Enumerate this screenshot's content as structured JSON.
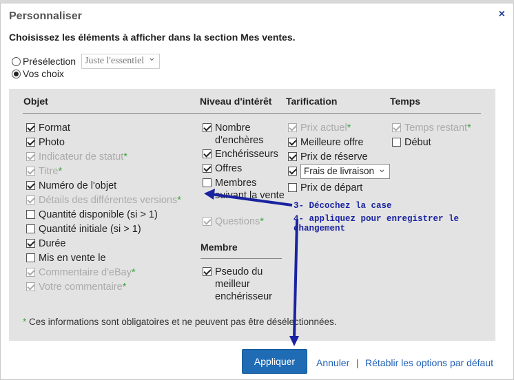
{
  "dialog": {
    "title": "Personnaliser",
    "close": "×",
    "subtitle": "Choisissez les éléments à afficher dans la section Mes ventes."
  },
  "view": {
    "preselection_label": "Présélection",
    "preselection_value": "Juste l'essentiel",
    "custom_label": "Vos choix",
    "selected": "Vos choix"
  },
  "columns": {
    "objet": "Objet",
    "interet": "Niveau d'intérêt",
    "tarification": "Tarification",
    "temps": "Temps",
    "membre": "Membre"
  },
  "objet_items": [
    {
      "label": "Format",
      "checked": true,
      "disabled": false,
      "required": false
    },
    {
      "label": "Photo",
      "checked": true,
      "disabled": false,
      "required": false
    },
    {
      "label": "Indicateur de statut",
      "checked": true,
      "disabled": true,
      "required": true
    },
    {
      "label": "Titre",
      "checked": true,
      "disabled": true,
      "required": true
    },
    {
      "label": "Numéro de l'objet",
      "checked": true,
      "disabled": false,
      "required": false
    },
    {
      "label": "Détails des différentes versions",
      "checked": true,
      "disabled": true,
      "required": true
    },
    {
      "label": "Quantité disponible (si > 1)",
      "checked": false,
      "disabled": false,
      "required": false
    },
    {
      "label": "Quantité initiale (si > 1)",
      "checked": false,
      "disabled": false,
      "required": false
    },
    {
      "label": "Durée",
      "checked": true,
      "disabled": false,
      "required": false
    },
    {
      "label": "Mis en vente le",
      "checked": false,
      "disabled": false,
      "required": false
    },
    {
      "label": "Commentaire d'eBay",
      "checked": true,
      "disabled": true,
      "required": true
    },
    {
      "label": "Votre commentaire",
      "checked": true,
      "disabled": true,
      "required": true
    }
  ],
  "interet_items": [
    {
      "label": "Nombre d'enchères",
      "checked": true,
      "disabled": false,
      "required": false
    },
    {
      "label": "Enchérisseurs",
      "checked": true,
      "disabled": false,
      "required": false
    },
    {
      "label": "Offres",
      "checked": true,
      "disabled": false,
      "required": false
    },
    {
      "label": "Membres suivant la vente",
      "checked": false,
      "disabled": false,
      "required": false
    },
    {
      "label": "Questions",
      "checked": true,
      "disabled": true,
      "required": true
    }
  ],
  "membre_items": [
    {
      "label": "Pseudo du meilleur enchérisseur",
      "checked": true,
      "disabled": false,
      "required": false
    }
  ],
  "tarification_items": [
    {
      "label": "Prix actuel",
      "checked": true,
      "disabled": true,
      "required": true
    },
    {
      "label": "Meilleure offre",
      "checked": true,
      "disabled": false,
      "required": false
    },
    {
      "label": "Prix de réserve",
      "checked": true,
      "disabled": false,
      "required": false
    },
    {
      "label": "Frais de livraison",
      "checked": true,
      "disabled": false,
      "required": false,
      "is_select": true
    },
    {
      "label": "Prix de départ",
      "checked": false,
      "disabled": false,
      "required": false
    }
  ],
  "temps_items": [
    {
      "label": "Temps restant",
      "checked": true,
      "disabled": true,
      "required": true
    },
    {
      "label": "Début",
      "checked": false,
      "disabled": false,
      "required": false
    }
  ],
  "required_star": "*",
  "footnote_star": "*",
  "footnote_text": " Ces informations sont obligatoires et ne peuvent pas être désélectionnées.",
  "actions": {
    "apply": "Appliquer",
    "cancel": "Annuler",
    "separator": "|",
    "reset": "Rétablir les options par défaut"
  },
  "annotations": {
    "step3": "3- Décochez la case",
    "step4": "4- appliquez pour enregistrer le changement",
    "color": "#1a23a0"
  },
  "colors": {
    "accent_button": "#1f6cb5",
    "link": "#1f5fb5",
    "required_star": "#3aa63a",
    "panel": "#e3e3e3"
  }
}
